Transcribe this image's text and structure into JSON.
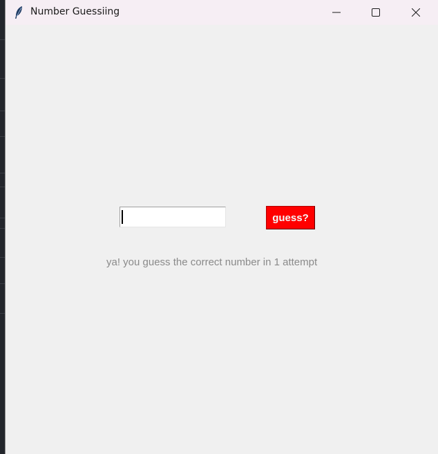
{
  "window": {
    "title": "Number Guessiing",
    "controls": {
      "minimize_icon": "minimize-icon",
      "maximize_icon": "maximize-icon",
      "close_icon": "close-icon"
    }
  },
  "form": {
    "input_value": "",
    "button_label": "guess?",
    "button_color": "#ff0000"
  },
  "status": {
    "message": "ya! you guess the correct number in 1 attempt"
  }
}
